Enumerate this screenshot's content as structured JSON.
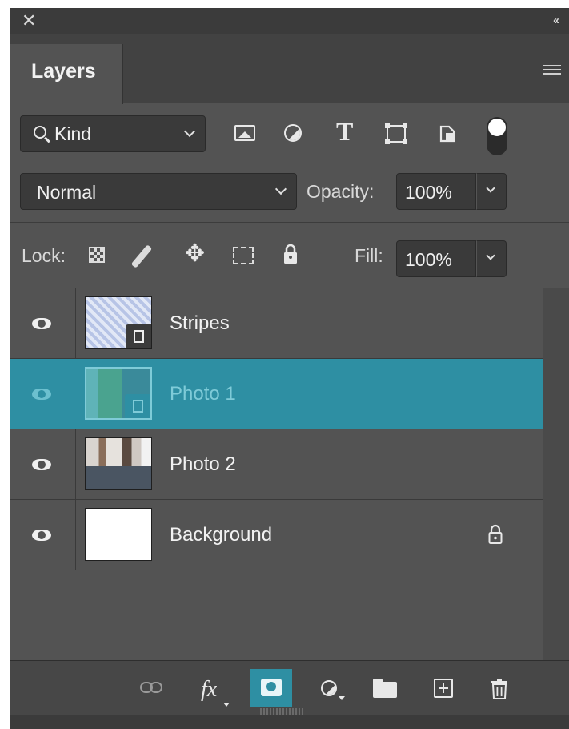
{
  "window": {
    "close_glyph": "✕",
    "collapse_glyph": "‹‹"
  },
  "panel": {
    "tab_label": "Layers",
    "menu_icon": "panel-menu-icon"
  },
  "filter": {
    "kind_label": "Kind",
    "icons": [
      "pixel-filter-icon",
      "adjustment-filter-icon",
      "type-filter-icon",
      "shape-filter-icon",
      "smart-object-filter-icon",
      "filter-toggle"
    ]
  },
  "blend": {
    "mode": "Normal",
    "opacity_label": "Opacity:",
    "opacity_value": "100%"
  },
  "lock": {
    "label": "Lock:",
    "icons": [
      "lock-transparency-icon",
      "lock-image-icon",
      "lock-position-icon",
      "lock-artboard-icon",
      "lock-all-icon"
    ],
    "fill_label": "Fill:",
    "fill_value": "100%"
  },
  "layers": [
    {
      "name": "Stripes",
      "selected": false,
      "visible": true,
      "type": "smart-object"
    },
    {
      "name": "Photo 1",
      "selected": true,
      "visible": true,
      "type": "smart-object"
    },
    {
      "name": "Photo 2",
      "selected": false,
      "visible": true,
      "type": "raster"
    },
    {
      "name": "Background",
      "selected": false,
      "visible": true,
      "type": "background",
      "locked": true
    }
  ],
  "footer": {
    "icons": [
      "link-layers-icon",
      "fx-icon",
      "add-mask-icon",
      "adjustment-layer-icon",
      "new-group-icon",
      "new-layer-icon",
      "trash-icon"
    ],
    "fx_text": "fx"
  },
  "colors": {
    "selected_row": "#2e8fa3",
    "panel_bg": "#535353",
    "dark_bg": "#3b3b3b"
  }
}
